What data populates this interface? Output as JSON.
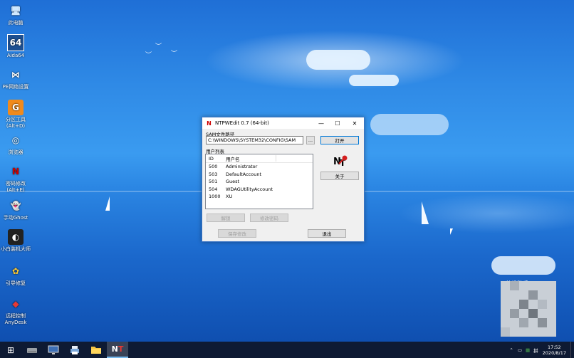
{
  "desktop": {
    "icons": [
      {
        "name": "this-pc-icon",
        "label": "此电脑",
        "glyph": "🖥"
      },
      {
        "name": "aida64-icon",
        "label": "Aida64",
        "glyph": "64"
      },
      {
        "name": "pe-network-icon",
        "label": "PE网络设置",
        "glyph": "⋈"
      },
      {
        "name": "partition-tool-icon",
        "label": "分区工具 (Alt+D)",
        "glyph": "G"
      },
      {
        "name": "browser-icon",
        "label": "浏览器",
        "glyph": "◎"
      },
      {
        "name": "password-change-icon",
        "label": "密码修改 (Alt+E)",
        "glyph": "N"
      },
      {
        "name": "manual-ghost-icon",
        "label": "手动Ghost",
        "glyph": "👻"
      },
      {
        "name": "xiaobai-install-icon",
        "label": "小白装机大师",
        "glyph": "◐"
      },
      {
        "name": "boot-repair-icon",
        "label": "引导修复",
        "glyph": "✿"
      },
      {
        "name": "anydesk-icon",
        "label": "远程控制 AnyDesk",
        "glyph": "◆"
      }
    ],
    "watermark": "装机助手"
  },
  "window": {
    "title": "NTPWEdit 0.7 (64-bit)",
    "sam_label": "SAM文件路径",
    "sam_path": "C:\\WINDOWS\\SYSTEM32\\CONFIG\\SAM",
    "browse_label": "...",
    "open_label": "打开",
    "about_label": "关于",
    "user_list_label": "用户列表",
    "columns": [
      "ID",
      "用户名"
    ],
    "users": [
      {
        "id": "500",
        "name": "Administrator"
      },
      {
        "id": "503",
        "name": "DefaultAccount"
      },
      {
        "id": "501",
        "name": "Guest"
      },
      {
        "id": "504",
        "name": "WDAGUtilityAccount"
      },
      {
        "id": "1000",
        "name": "XU"
      }
    ],
    "unlock_label": "解锁",
    "change_password_label": "修改密码",
    "save_changes_label": "保存修改",
    "exit_label": "退出",
    "minimize_glyph": "—",
    "maximize_glyph": "☐",
    "close_glyph": "✕"
  },
  "taskbar": {
    "start_glyph": "⊞",
    "time": "17:52",
    "date": "2020/8/17",
    "ime": "拼"
  }
}
